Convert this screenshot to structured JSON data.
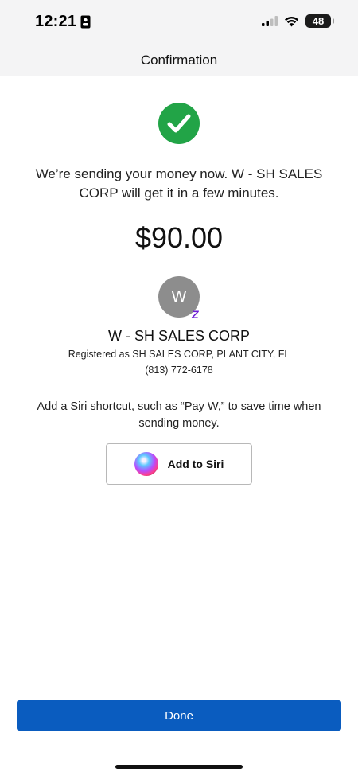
{
  "status_bar": {
    "time": "12:21",
    "battery": "48"
  },
  "header": {
    "title": "Confirmation"
  },
  "confirmation": {
    "message": "We’re sending your money now. W - SH SALES CORP  will get it in a few minutes.",
    "amount": "$90.00"
  },
  "recipient": {
    "avatar_initial": "W",
    "badge_symbol": "Z",
    "name": "W - SH SALES CORP",
    "registered_as": "Registered as SH SALES CORP, PLANT CITY, FL",
    "phone": "(813) 772-6178"
  },
  "siri": {
    "description": "Add a Siri shortcut, such as “Pay W,” to save time when sending money.",
    "button_label": "Add to Siri"
  },
  "footer": {
    "done_label": "Done"
  },
  "colors": {
    "success": "#22a447",
    "primary": "#0a5cbf",
    "zelle": "#6d1ed4",
    "avatar": "#8d8d8d"
  },
  "icons": [
    "id-card-icon",
    "cellular-signal-icon",
    "wifi-icon",
    "battery-icon",
    "checkmark-icon",
    "zelle-icon",
    "siri-icon"
  ]
}
